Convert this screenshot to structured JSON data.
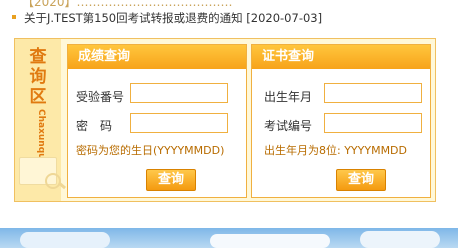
{
  "notice": {
    "title": "关于J.TEST第150回考试转报或退费的通知",
    "date": "[2020-07-03]"
  },
  "side": {
    "title_line1": "查询",
    "title_line2": "区",
    "pinyin": "Chaxunqu"
  },
  "score_panel": {
    "title": "成绩查询",
    "exam_no_label": "受验番号",
    "password_label": "密　码",
    "exam_no_value": "",
    "password_value": "",
    "hint": "密码为您的生日(YYYYMMDD)",
    "button_label": "查询"
  },
  "cert_panel": {
    "title": "证书查询",
    "birth_label": "出生年月",
    "exam_id_label": "考试编号",
    "birth_value": "",
    "exam_id_value": "",
    "hint": "出生年月为8位: YYYYMMDD",
    "button_label": "查询"
  },
  "colors": {
    "accent": "#f7a31a",
    "panel_bg": "#fff8d8",
    "hint": "#b86c00"
  }
}
